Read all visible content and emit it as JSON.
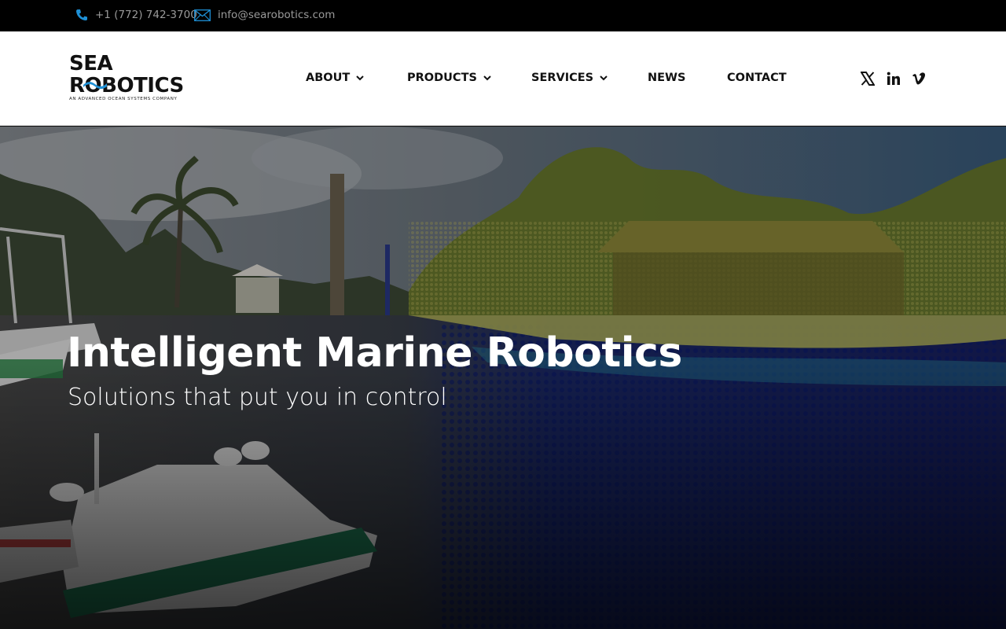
{
  "topbar": {
    "phone": "+1 (772) 742-3700",
    "email": "info@searobotics.com"
  },
  "logo": {
    "line1": "SEA",
    "line2_prefix": "R",
    "line2_o": "O",
    "line2_suffix": "BOTICS",
    "tagline": "AN ADVANCED OCEAN SYSTEMS COMPANY"
  },
  "nav": {
    "items": [
      {
        "label": "ABOUT",
        "dropdown": true
      },
      {
        "label": "PRODUCTS",
        "dropdown": true
      },
      {
        "label": "SERVICES",
        "dropdown": true
      },
      {
        "label": "NEWS",
        "dropdown": false
      },
      {
        "label": "CONTACT",
        "dropdown": false
      }
    ]
  },
  "social": [
    "x-icon",
    "linkedin-icon",
    "vimeo-icon"
  ],
  "hero": {
    "title": "Intelligent Marine Robotics",
    "subtitle": "Solutions that put you in control"
  },
  "colors": {
    "accent": "#1e90d6",
    "topbar_bg": "#000000",
    "header_bg": "#ffffff",
    "hero_text": "#ffffff"
  }
}
